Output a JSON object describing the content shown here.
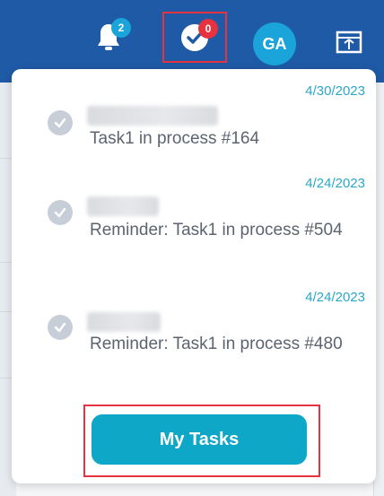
{
  "header": {
    "notification_badge": "2",
    "tasks_badge": "0",
    "avatar_initials": "GA"
  },
  "tasks": [
    {
      "date": "4/30/2023",
      "title": "Task1 in process #164"
    },
    {
      "date": "4/24/2023",
      "title": "Reminder: Task1 in process #504"
    },
    {
      "date": "4/24/2023",
      "title": "Reminder: Task1 in process #480"
    }
  ],
  "footer": {
    "button_label": "My Tasks"
  },
  "colors": {
    "topbar": "#1f5aa6",
    "accent": "#1aa4d9",
    "alert": "#e6333f",
    "cta": "#0ea7c8"
  }
}
